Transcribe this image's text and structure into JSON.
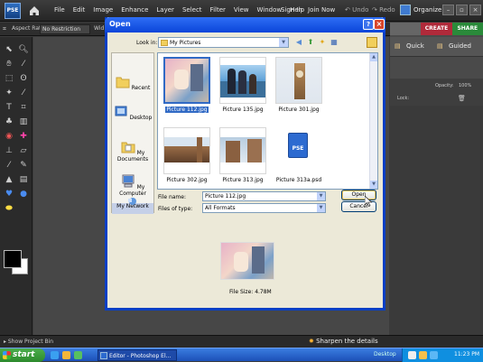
{
  "app": {
    "logo_text": "PSE",
    "menus": [
      "File",
      "Edit",
      "Image",
      "Enhance",
      "Layer",
      "Select",
      "Filter",
      "View",
      "Window",
      "Help"
    ],
    "sign_in": "Sign In",
    "join_now": "Join Now",
    "undo": "Undo",
    "redo": "Redo",
    "organizer": "Organizer"
  },
  "options_bar": {
    "aspect_ratio_label": "Aspect Ratio:",
    "aspect_ratio_value": "No Restriction",
    "width_label": "Wid"
  },
  "right_panel": {
    "tabs": [
      "CREATE",
      "SHARE"
    ],
    "subtabs": [
      "Quick",
      "Guided"
    ],
    "opacity_label": "Opacity:",
    "opacity_value": "100%",
    "lock_label": "Lock:"
  },
  "dialog": {
    "title": "Open",
    "look_in_label": "Look in:",
    "look_in_value": "My Pictures",
    "places": [
      "Recent",
      "Desktop",
      "My Documents",
      "My Computer",
      "My Network"
    ],
    "files": [
      {
        "name": "Picture 112.jpg"
      },
      {
        "name": "Picture 135.jpg"
      },
      {
        "name": "Picture 301.jpg"
      },
      {
        "name": "Picture 302.jpg"
      },
      {
        "name": "Picture 313.jpg"
      },
      {
        "name": "Picture 313a.psd"
      }
    ],
    "file_name_label": "File name:",
    "file_name_value": "Picture 112.jpg",
    "files_of_type_label": "Files of type:",
    "files_of_type_value": "All Formats",
    "open_button": "Open",
    "cancel_button": "Cancel",
    "file_size": "File Size: 4.78M"
  },
  "bottom_bar": {
    "project_bin": "Show Project Bin",
    "hint": "Sharpen the details"
  },
  "taskbar": {
    "start": "start",
    "task": "Editor - Photoshop El...",
    "desktop": "Desktop",
    "clock": "11:23 PM"
  }
}
